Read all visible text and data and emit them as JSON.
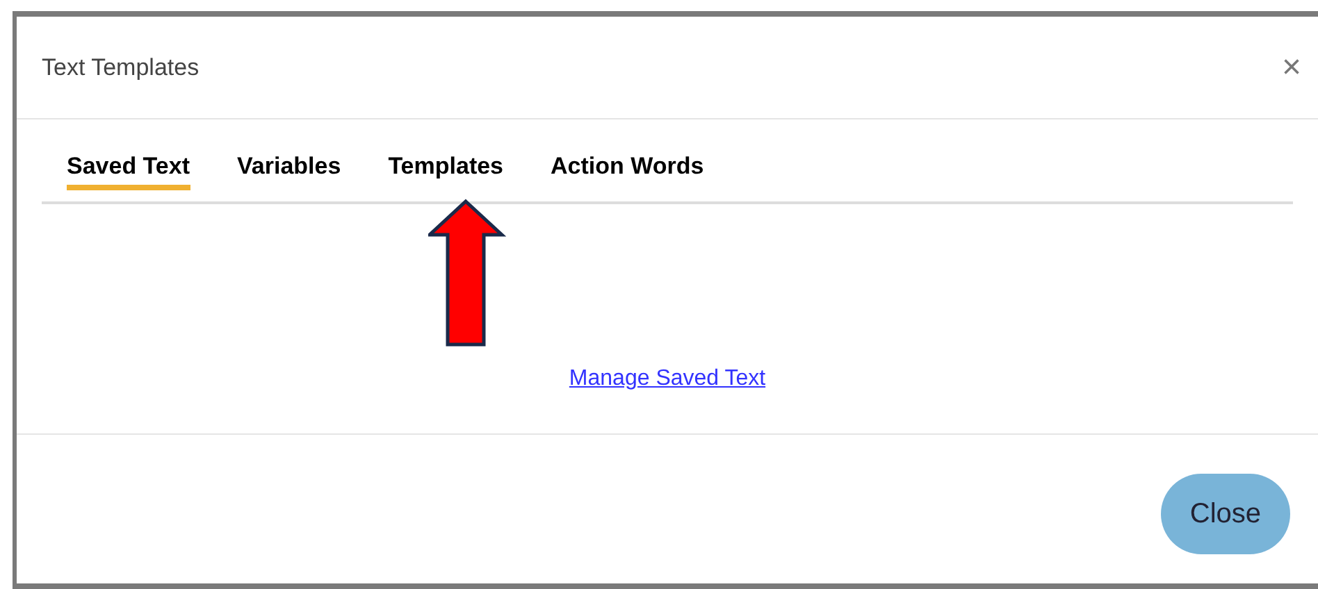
{
  "dialog": {
    "title": "Text Templates",
    "close_icon": "×"
  },
  "tabs": [
    {
      "label": "Saved Text",
      "selected": true
    },
    {
      "label": "Variables",
      "selected": false
    },
    {
      "label": "Templates",
      "selected": false
    },
    {
      "label": "Action Words",
      "selected": false
    }
  ],
  "content": {
    "link": "Manage Saved Text"
  },
  "annotation": {
    "kind": "arrow"
  },
  "footer": {
    "buttons": [
      "Close"
    ]
  }
}
